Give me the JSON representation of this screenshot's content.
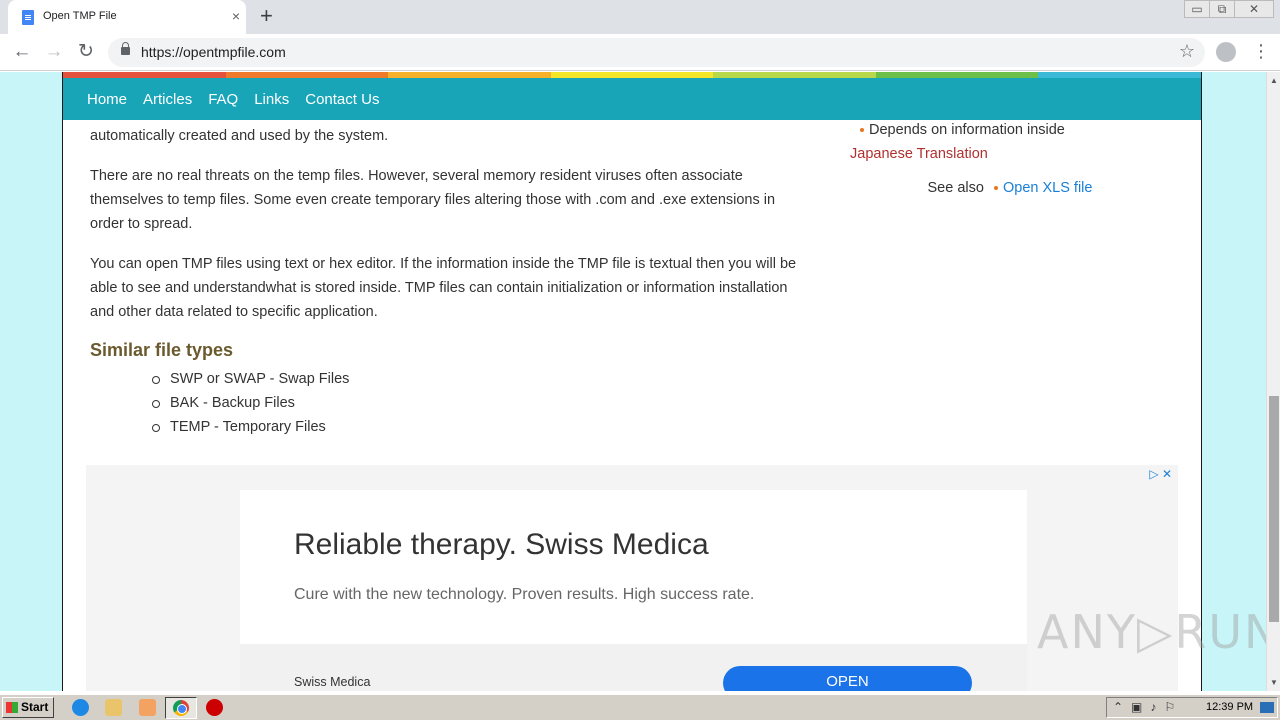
{
  "browser": {
    "tab_title": "Open TMP File",
    "url": "https://opentmpfile.com",
    "new_tab_symbol": "+",
    "tab_close_symbol": "×"
  },
  "window_controls": {
    "minimize": "▭",
    "maximize": "⧉",
    "close": "✕"
  },
  "nav": {
    "items": [
      {
        "label": "Home"
      },
      {
        "label": "Articles"
      },
      {
        "label": "FAQ"
      },
      {
        "label": "Links"
      },
      {
        "label": "Contact Us"
      }
    ],
    "rainbow_colors": [
      "#e4513d",
      "#f07a2c",
      "#f5b12a",
      "#f2e626",
      "#b7d84b",
      "#6cc04a",
      "#3bb9d6"
    ],
    "bar_color": "#18a5b8"
  },
  "content": {
    "para1_tail": "automatically created and used by the system.",
    "para2": "There are no real threats on the temp files. However, several memory resident viruses often associate themselves to temp files. Some even create temporary files altering those with .com and .exe extensions in order to spread.",
    "para3": "You can open TMP files using text or hex editor. If the information inside the TMP file is textual then you will be able to see and understandwhat is stored inside. TMP files can contain initialization or information installation and other data related to specific application.",
    "similar_heading": "Similar file types",
    "similar_types": [
      {
        "label": "SWP or SWAP - Swap Files"
      },
      {
        "label": "BAK - Backup Files"
      },
      {
        "label": "TEMP - Temporary Files"
      }
    ]
  },
  "sidebar": {
    "bullet_text": "Depends on information inside",
    "japanese_link": "Japanese Translation",
    "see_also_label": "See also",
    "see_also_link": "Open XLS file"
  },
  "ad": {
    "title": "Reliable therapy. Swiss Medica",
    "subtitle": "Cure with the new technology. Proven results. High success rate.",
    "brand": "Swiss Medica",
    "cta": "OPEN",
    "choices_icons": "▷ ✕"
  },
  "watermark": "ANY▷RUN",
  "taskbar": {
    "start_label": "Start",
    "clock": "12:39 PM"
  }
}
